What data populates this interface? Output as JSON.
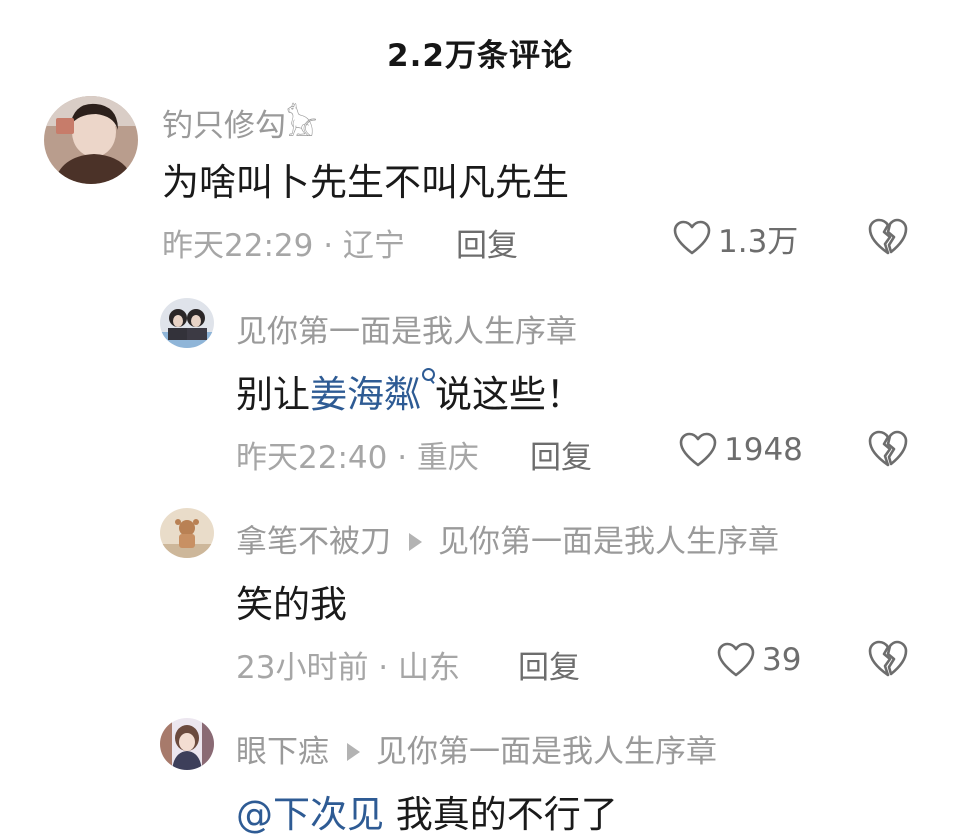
{
  "header": {
    "title": "2.2万条评论"
  },
  "comments": [
    {
      "username": "钓只修勾𓃠",
      "content": "为啥叫卜先生不叫凡先生",
      "meta": "昨天22:29 · 辽宁",
      "reply_label": "回复",
      "likes": "1.3万"
    },
    {
      "username": "见你第一面是我人生序章",
      "content_prefix": "别让",
      "content_link": "姜海粼",
      "content_suffix": "说这些！",
      "meta": "昨天22:40 · 重庆",
      "reply_label": "回复",
      "likes": "1948"
    },
    {
      "username": "拿笔不被刀",
      "reply_to": "见你第一面是我人生序章",
      "content": "笑的我",
      "meta": "23小时前 · 山东",
      "reply_label": "回复",
      "likes": "39"
    },
    {
      "username": "眼下痣",
      "reply_to": "见你第一面是我人生序章",
      "content_mention": "@下次见",
      "content_text": "我真的不行了"
    }
  ],
  "icons": {
    "like": "heart-outline-icon",
    "dislike": "broken-heart-icon",
    "reply_arrow": "play-triangle-icon",
    "search": "search-icon"
  },
  "colors": {
    "link": "#2e5b94",
    "meta": "#a6a6a6",
    "username": "#9a9a9a"
  }
}
